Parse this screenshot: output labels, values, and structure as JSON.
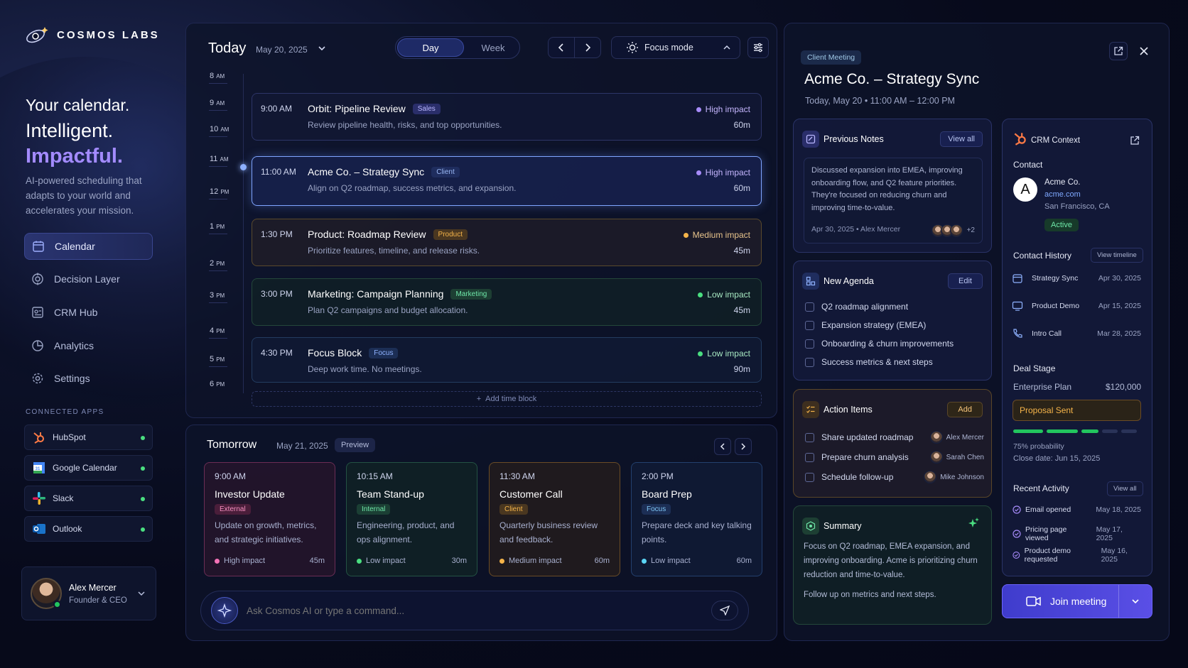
{
  "brand": {
    "name": "COSMOS LABS"
  },
  "hero": {
    "line1": "Your calendar.",
    "line2": "Intelligent.",
    "line3": "Impactful.",
    "desc": "AI-powered scheduling that adapts to your world and accelerates your mission."
  },
  "nav": [
    {
      "label": "Calendar",
      "icon": "calendar-icon",
      "active": true
    },
    {
      "label": "Decision Layer",
      "icon": "target-icon"
    },
    {
      "label": "CRM Hub",
      "icon": "crm-icon"
    },
    {
      "label": "Analytics",
      "icon": "pie-chart-icon"
    },
    {
      "label": "Settings",
      "icon": "gear-icon"
    }
  ],
  "connected_apps": {
    "title": "CONNECTED APPS",
    "items": [
      {
        "name": "HubSpot",
        "status": "connected"
      },
      {
        "name": "Google Calendar",
        "status": "connected"
      },
      {
        "name": "Slack",
        "status": "connected"
      },
      {
        "name": "Outlook",
        "status": "connected"
      }
    ]
  },
  "user": {
    "name": "Alex Mercer",
    "role": "Founder & CEO"
  },
  "today": {
    "title": "Today",
    "date": "May 20, 2025",
    "view_day": "Day",
    "view_week": "Week",
    "focus_mode": "Focus mode",
    "hours": [
      {
        "h": "8",
        "ap": "AM"
      },
      {
        "h": "9",
        "ap": "AM"
      },
      {
        "h": "10",
        "ap": "AM"
      },
      {
        "h": "11",
        "ap": "AM"
      },
      {
        "h": "12",
        "ap": "PM"
      },
      {
        "h": "1",
        "ap": "PM"
      },
      {
        "h": "2",
        "ap": "PM"
      },
      {
        "h": "3",
        "ap": "PM"
      },
      {
        "h": "4",
        "ap": "PM"
      },
      {
        "h": "5",
        "ap": "PM"
      },
      {
        "h": "6",
        "ap": "PM"
      }
    ],
    "events": [
      {
        "time": "9:00 AM",
        "title": "Orbit: Pipeline Review",
        "tag": "Sales",
        "desc": "Review pipeline health, risks, and top opportunities.",
        "impact": "High impact",
        "duration": "60m"
      },
      {
        "time": "11:00 AM",
        "title": "Acme Co. – Strategy Sync",
        "tag": "Client",
        "desc": "Align on Q2 roadmap, success metrics, and expansion.",
        "impact": "High impact",
        "duration": "60m"
      },
      {
        "time": "1:30 PM",
        "title": "Product: Roadmap Review",
        "tag": "Product",
        "desc": "Prioritize features, timeline, and release risks.",
        "impact": "Medium impact",
        "duration": "45m"
      },
      {
        "time": "3:00 PM",
        "title": "Marketing: Campaign Planning",
        "tag": "Marketing",
        "desc": "Plan Q2 campaigns and budget allocation.",
        "impact": "Low impact",
        "duration": "45m"
      },
      {
        "time": "4:30 PM",
        "title": "Focus Block",
        "tag": "Focus",
        "desc": "Deep work time. No meetings.",
        "impact": "Low impact",
        "duration": "90m"
      }
    ],
    "add_block": "Add time block"
  },
  "tomorrow": {
    "title": "Tomorrow",
    "date": "May 21, 2025",
    "badge": "Preview",
    "cards": [
      {
        "time": "9:00 AM",
        "title": "Investor Update",
        "tag": "External",
        "desc": "Update on growth, metrics, and strategic initiatives.",
        "impact": "High impact",
        "duration": "45m"
      },
      {
        "time": "10:15 AM",
        "title": "Team Stand-up",
        "tag": "Internal",
        "desc": "Engineering, product, and ops alignment.",
        "impact": "Low impact",
        "duration": "30m"
      },
      {
        "time": "11:30 AM",
        "title": "Customer Call",
        "tag": "Client",
        "desc": "Quarterly business review and feedback.",
        "impact": "Medium impact",
        "duration": "60m"
      },
      {
        "time": "2:00 PM",
        "title": "Board Prep",
        "tag": "Focus",
        "desc": "Prepare deck and key talking points.",
        "impact": "Low impact",
        "duration": "60m"
      }
    ]
  },
  "command": {
    "placeholder": "Ask Cosmos AI or type a command..."
  },
  "meeting": {
    "tag": "Client Meeting",
    "title": "Acme Co. – Strategy Sync",
    "when": "Today, May 20  •  11:00 AM – 12:00 PM",
    "notes": {
      "title": "Previous Notes",
      "button": "View all",
      "text": "Discussed expansion into EMEA, improving onboarding flow, and Q2 feature priorities. They're focused on reducing churn and improving time-to-value.",
      "meta": "Apr 30, 2025  •  Alex Mercer",
      "extra": "+2"
    },
    "agenda": {
      "title": "New Agenda",
      "button": "Edit",
      "items": [
        "Q2 roadmap alignment",
        "Expansion strategy (EMEA)",
        "Onboarding & churn improvements",
        "Success metrics & next steps"
      ]
    },
    "actions": {
      "title": "Action Items",
      "button": "Add",
      "items": [
        {
          "task": "Share updated roadmap",
          "owner": "Alex Mercer"
        },
        {
          "task": "Prepare churn analysis",
          "owner": "Sarah Chen"
        },
        {
          "task": "Schedule follow-up",
          "owner": "Mike Johnson"
        }
      ]
    },
    "summary": {
      "title": "Summary",
      "p1": "Focus on Q2 roadmap, EMEA expansion, and improving onboarding. Acme is prioritizing churn reduction and time-to-value.",
      "p2": "Follow up on metrics and next steps."
    }
  },
  "crm": {
    "title": "CRM Context",
    "contact_label": "Contact",
    "company": "Acme Co.",
    "website": "acme.com",
    "location": "San Francisco, CA",
    "status": "Active",
    "avatar_letter": "A",
    "history_title": "Contact History",
    "history_button": "View timeline",
    "history": [
      {
        "label": "Strategy Sync",
        "date": "Apr 30, 2025"
      },
      {
        "label": "Product Demo",
        "date": "Apr 15, 2025"
      },
      {
        "label": "Intro Call",
        "date": "Mar 28, 2025"
      }
    ],
    "deal_title": "Deal Stage",
    "deal_plan": "Enterprise Plan",
    "deal_value": "$120,000",
    "deal_stage": "Proposal Sent",
    "probability": "75% probability",
    "probability_value": 0.75,
    "close_date": "Close date: Jun 15, 2025",
    "activity_title": "Recent Activity",
    "activity_button": "View all",
    "activity": [
      {
        "label": "Email opened",
        "date": "May 18, 2025"
      },
      {
        "label": "Pricing page viewed",
        "date": "May 17, 2025"
      },
      {
        "label": "Product demo requested",
        "date": "May 16, 2025"
      }
    ]
  },
  "join": {
    "label": "Join meeting"
  },
  "colors": {
    "accent": "#6c63ff",
    "high": "#a78bfa",
    "medium": "#f5b44a",
    "low": "#4ade80",
    "focus": "#60a5fa"
  }
}
